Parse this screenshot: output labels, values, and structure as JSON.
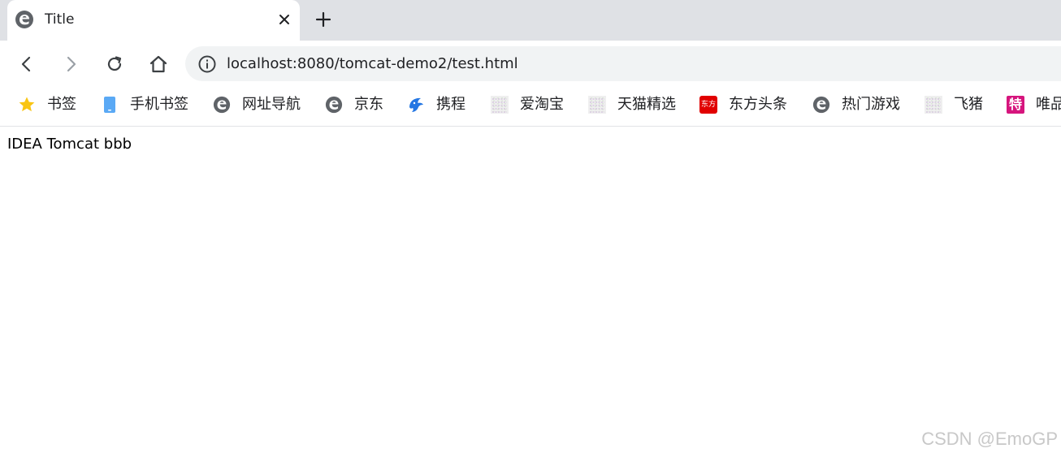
{
  "tab": {
    "title": "Title",
    "favicon": "edge-e-icon"
  },
  "toolbar": {
    "url": "localhost:8080/tomcat-demo2/test.html"
  },
  "bookmarks": [
    {
      "label": "书签",
      "icon": "star-icon",
      "color": "#f9c513"
    },
    {
      "label": "手机书签",
      "icon": "phone-icon",
      "color": "#5aa9f5"
    },
    {
      "label": "网址导航",
      "icon": "edge-e-icon",
      "color": "#5f6368"
    },
    {
      "label": "京东",
      "icon": "edge-e-icon",
      "color": "#5f6368"
    },
    {
      "label": "携程",
      "icon": "dolphin-icon",
      "color": "#2577e3"
    },
    {
      "label": "爱淘宝",
      "icon": "placeholder-image-icon",
      "color": "#d0d0d0"
    },
    {
      "label": "天猫精选",
      "icon": "placeholder-image-icon",
      "color": "#d0d0d0"
    },
    {
      "label": "东方头条",
      "icon": "dongfang-icon",
      "color": "#e10000"
    },
    {
      "label": "热门游戏",
      "icon": "edge-e-icon",
      "color": "#5f6368"
    },
    {
      "label": "飞猪",
      "icon": "placeholder-image-icon",
      "color": "#d0d0d0"
    },
    {
      "label": "唯品会",
      "icon": "te-badge-icon",
      "color": "#d6157d"
    }
  ],
  "page": {
    "body_text": "IDEA Tomcat bbb"
  },
  "watermark": "CSDN @EmoGP",
  "icon_text": {
    "dongfang": "东方",
    "te": "特"
  }
}
